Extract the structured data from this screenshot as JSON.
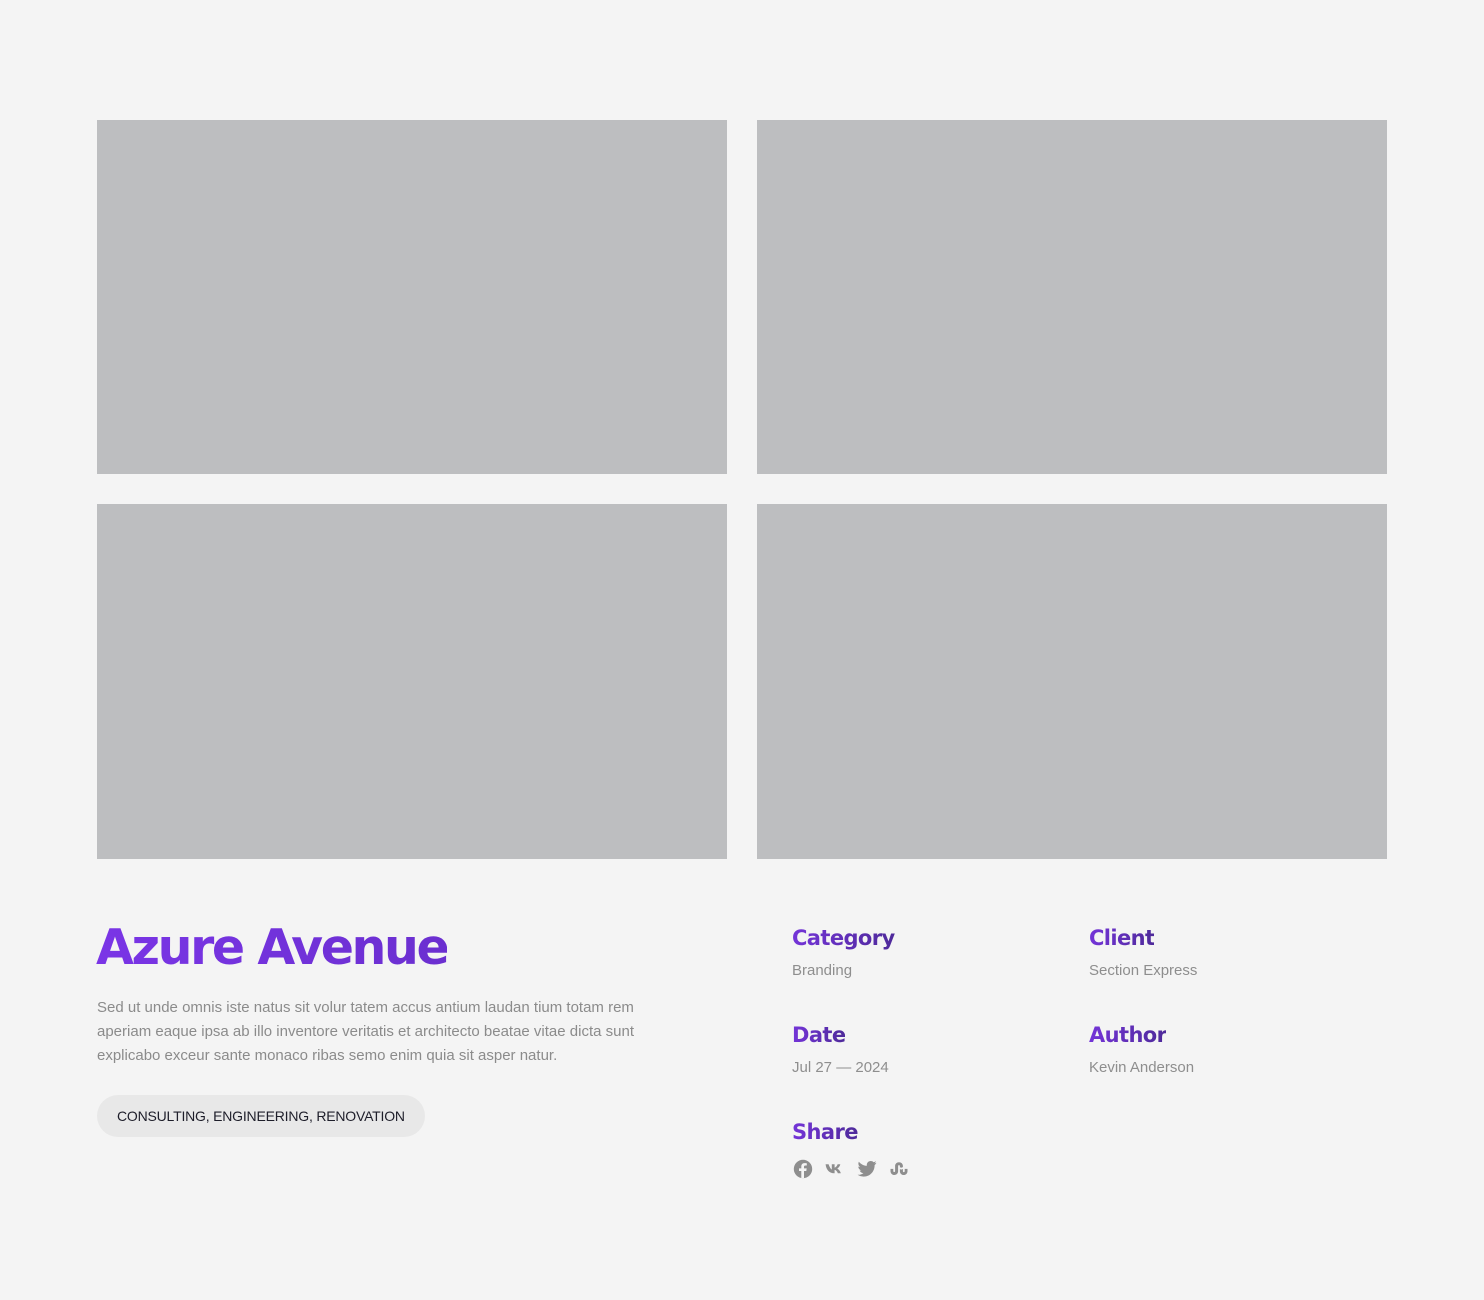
{
  "gallery": {
    "images": [
      {
        "alt": "project-image-1"
      },
      {
        "alt": "project-image-2"
      },
      {
        "alt": "project-image-3"
      },
      {
        "alt": "project-image-4"
      }
    ],
    "placeholder_color": "#bdbec0"
  },
  "project": {
    "title": "Azure Avenue",
    "description": "Sed ut unde omnis iste natus sit volur tatem accus antium laudan tium totam rem aperiam eaque ipsa ab illo inventore veritatis et architecto beatae vitae dicta sunt explicabo exceur sante monaco ribas semo enim quia sit asper natur.",
    "tags": "CONSULTING, ENGINEERING, RENOVATION",
    "accent_color": "#7432dc"
  },
  "meta": {
    "category": {
      "label": "Category",
      "value": "Branding"
    },
    "client": {
      "label": "Client",
      "value": "Section Express"
    },
    "date": {
      "label": "Date",
      "value": "Jul 27 — 2024"
    },
    "author": {
      "label": "Author",
      "value": "Kevin Anderson"
    }
  },
  "share": {
    "label": "Share",
    "icons": [
      "facebook-icon",
      "vk-icon",
      "twitter-icon",
      "stumbleupon-icon"
    ],
    "icon_color": "#8e8e8e"
  }
}
